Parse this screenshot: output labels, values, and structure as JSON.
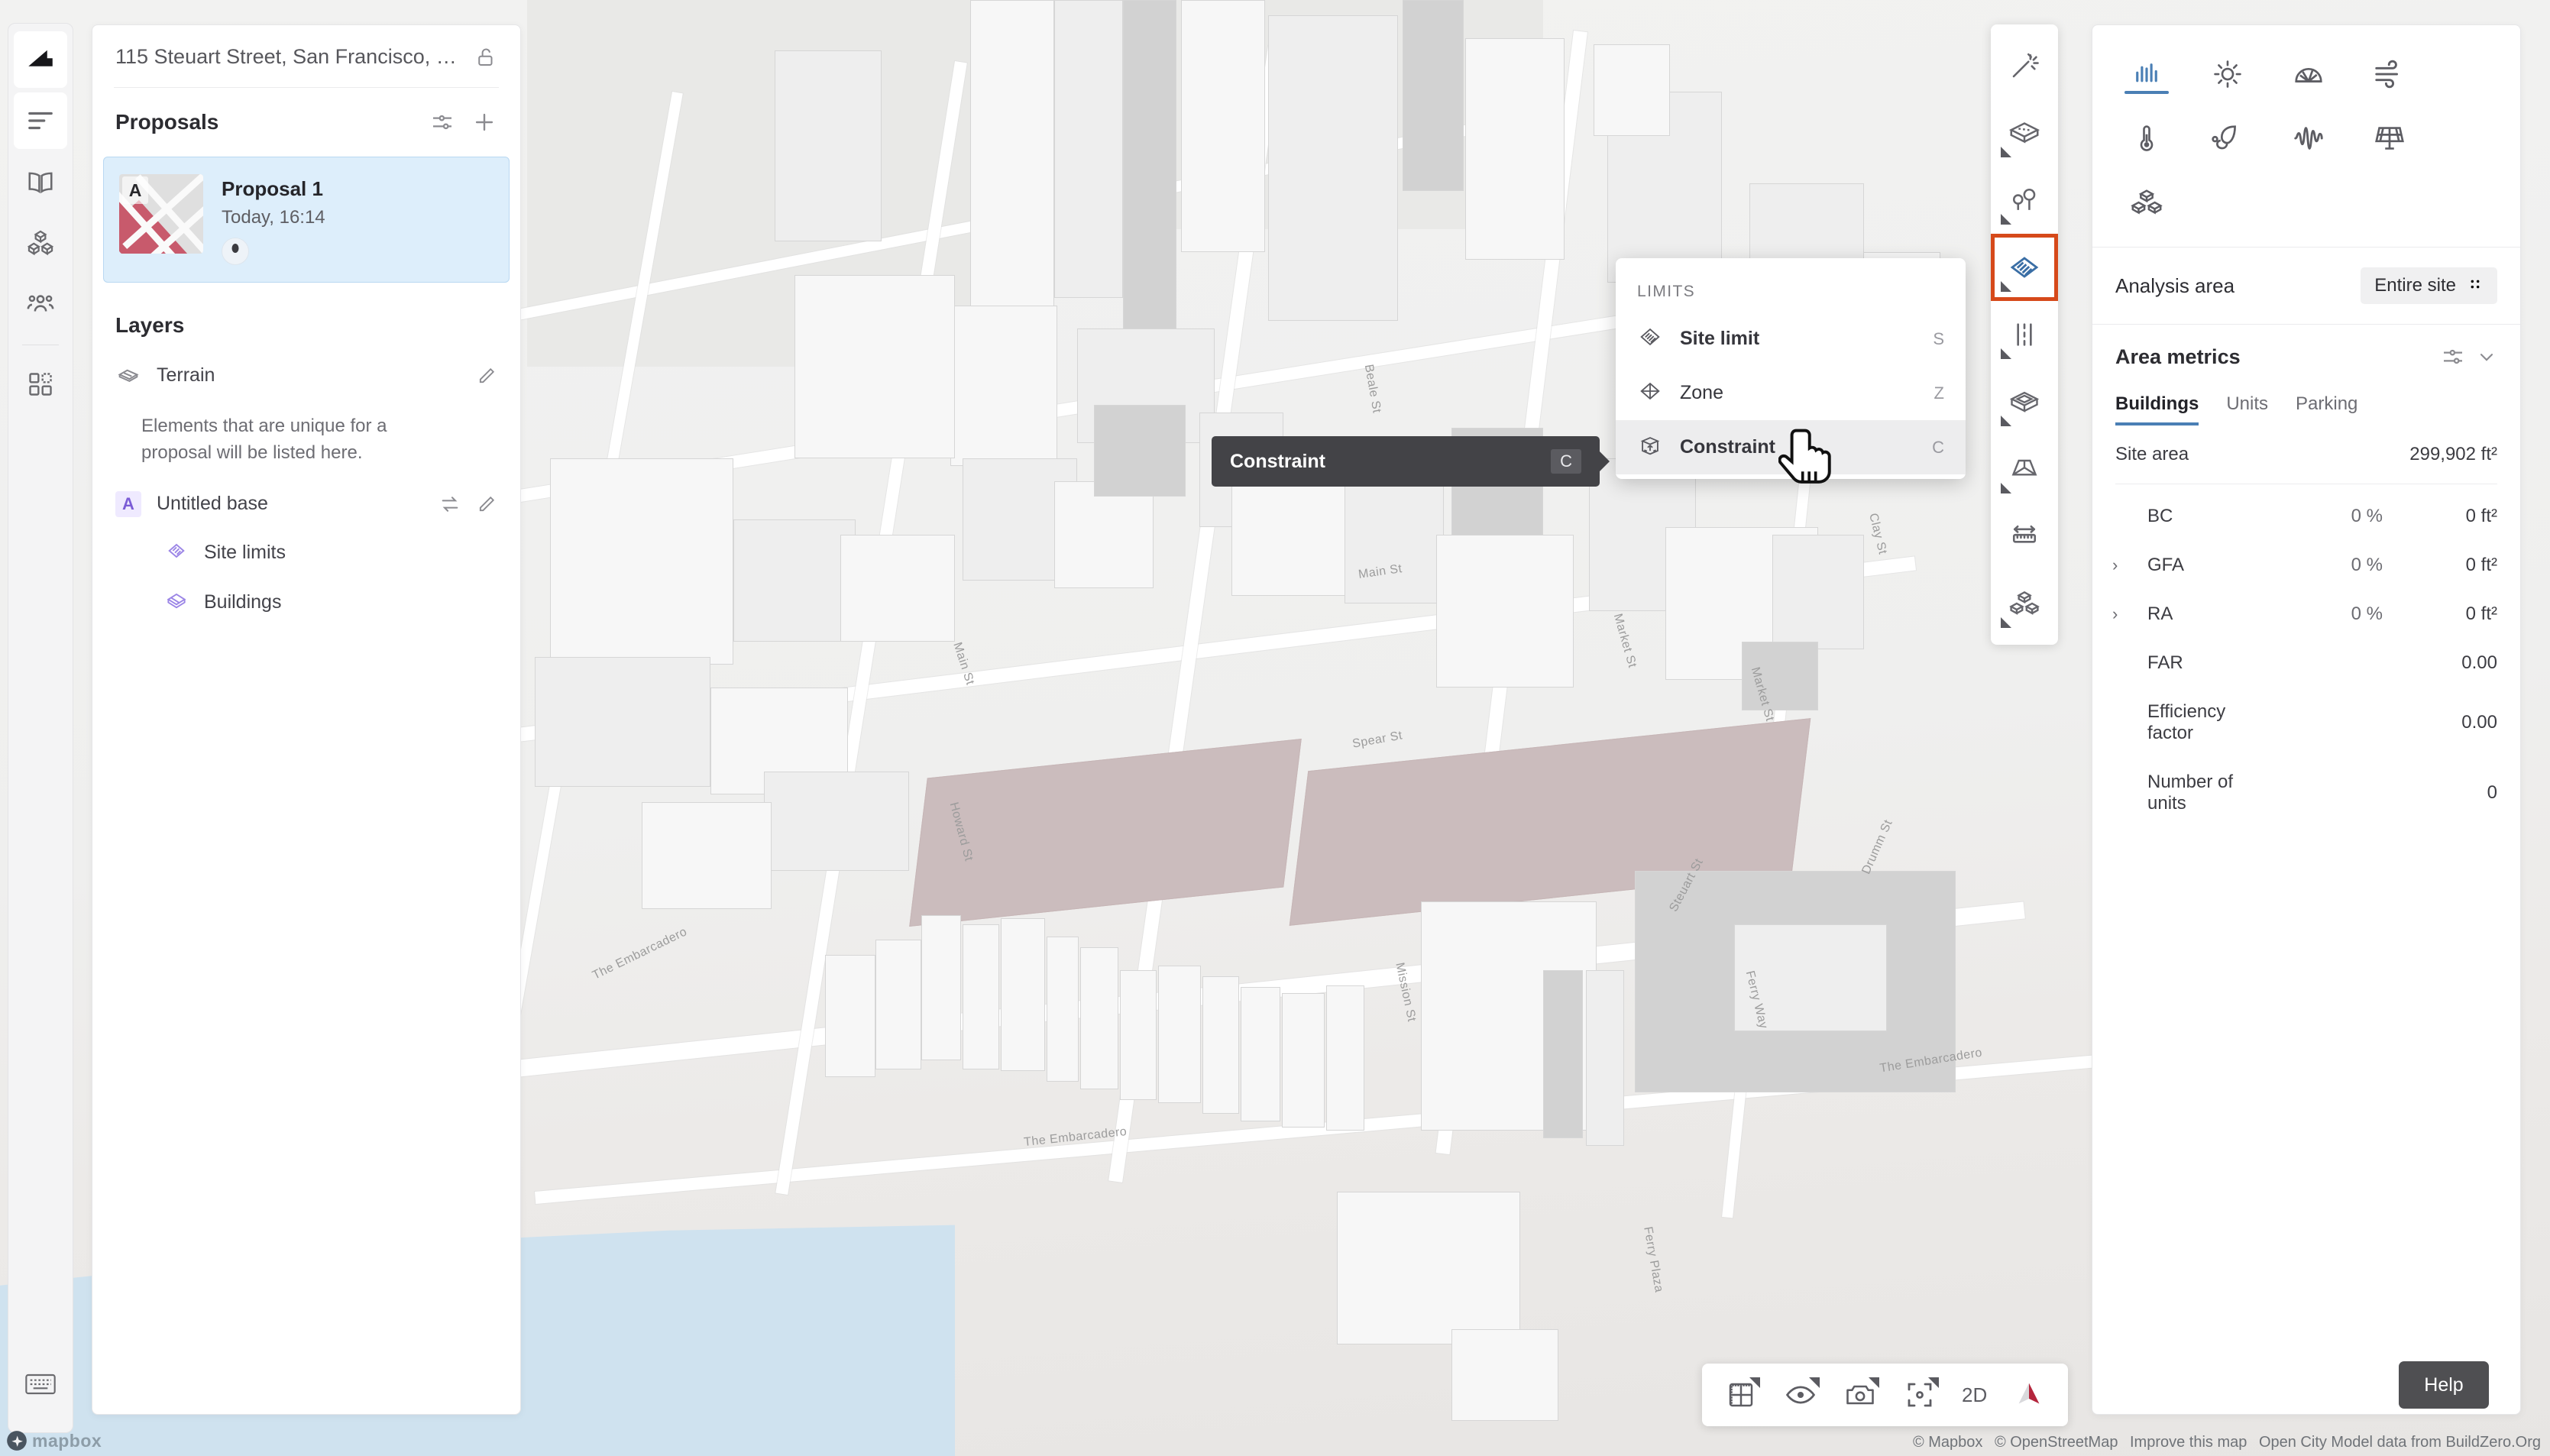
{
  "app": {
    "project_address": "115 Steuart Street, San Francisco, …",
    "lock_icon": "unlock-icon",
    "logo_icon": "app-logo-icon"
  },
  "rail": {
    "items": [
      {
        "icon": "app-logo-icon",
        "name": "logo"
      },
      {
        "icon": "list-icon",
        "name": "project-list"
      },
      {
        "icon": "book-icon",
        "name": "library"
      },
      {
        "icon": "blocks-icon",
        "name": "massing"
      },
      {
        "icon": "people-icon",
        "name": "team"
      },
      {
        "icon": "apps-grid-icon",
        "name": "apps"
      }
    ],
    "bottom_icon": "keyboard-icon"
  },
  "proposals": {
    "heading": "Proposals",
    "settings_icon": "sliders-icon",
    "add_icon": "plus-icon",
    "items": [
      {
        "badge": "A",
        "name": "Proposal 1",
        "timestamp": "Today, 16:14",
        "selected": true
      }
    ]
  },
  "layers": {
    "heading": "Layers",
    "terrain": {
      "label": "Terrain",
      "icon": "terrain-icon",
      "edit_icon": "pencil-icon"
    },
    "hint": "Elements that are unique for a proposal will be listed here.",
    "base": {
      "badge": "A",
      "label": "Untitled base",
      "swap_icon": "swap-icon",
      "edit_icon": "pencil-icon",
      "children": [
        {
          "label": "Site limits",
          "icon": "site-limit-icon"
        },
        {
          "label": "Buildings",
          "icon": "buildings-icon"
        }
      ]
    }
  },
  "limits_menu": {
    "title": "LIMITS",
    "items": [
      {
        "label": "Site limit",
        "shortcut": "S",
        "icon": "site-limit-icon",
        "bold": true,
        "highlighted": false
      },
      {
        "label": "Zone",
        "shortcut": "Z",
        "icon": "zone-icon",
        "bold": false,
        "highlighted": false
      },
      {
        "label": "Constraint",
        "shortcut": "C",
        "icon": "constraint-icon",
        "bold": true,
        "highlighted": true
      }
    ]
  },
  "tooltip": {
    "label": "Constraint",
    "shortcut": "C"
  },
  "vertical_toolbar": {
    "items": [
      {
        "name": "magic-wand-icon",
        "active": false
      },
      {
        "name": "building-block-icon",
        "active": false
      },
      {
        "name": "trees-icon",
        "active": false
      },
      {
        "name": "site-limit-plane-icon",
        "active": true
      },
      {
        "name": "grid-lines-icon",
        "active": false
      },
      {
        "name": "extrusion-box-icon",
        "active": false
      },
      {
        "name": "volume-shape-icon",
        "active": false
      },
      {
        "name": "measure-arrow-icon",
        "active": false
      },
      {
        "name": "blocks-stack-icon",
        "active": false
      }
    ]
  },
  "analysis": {
    "icons": [
      {
        "name": "bar-chart-icon",
        "active": true
      },
      {
        "name": "sun-icon",
        "active": false
      },
      {
        "name": "daylight-dome-icon",
        "active": false
      },
      {
        "name": "wind-icon",
        "active": false
      },
      {
        "name": "thermometer-icon",
        "active": false
      },
      {
        "name": "carbon-leaf-icon",
        "active": false
      },
      {
        "name": "acoustics-wave-icon",
        "active": false
      },
      {
        "name": "solar-panel-icon",
        "active": false
      },
      {
        "name": "blocks-stack-icon",
        "active": false
      }
    ],
    "area_row": {
      "label": "Analysis area",
      "value": "Entire site",
      "picker_icon": "four-dots-icon"
    },
    "metrics_header": {
      "title": "Area metrics",
      "settings_icon": "sliders-icon",
      "collapse_icon": "chevron-down-icon"
    },
    "tabs": [
      {
        "label": "Buildings",
        "active": true
      },
      {
        "label": "Units",
        "active": false
      },
      {
        "label": "Parking",
        "active": false
      }
    ],
    "site_area": {
      "label": "Site area",
      "value": "299,902 ft²"
    },
    "rows": [
      {
        "label": "BC",
        "pct": "0 %",
        "value": "0 ft²",
        "expandable": false
      },
      {
        "label": "GFA",
        "pct": "0 %",
        "value": "0 ft²",
        "expandable": true
      },
      {
        "label": "RA",
        "pct": "0 %",
        "value": "0 ft²",
        "expandable": true
      },
      {
        "label": "FAR",
        "pct": "",
        "value": "0.00",
        "expandable": false
      },
      {
        "label": "Efficiency factor",
        "pct": "",
        "value": "0.00",
        "expandable": false
      },
      {
        "label": "Number of units",
        "pct": "",
        "value": "0",
        "expandable": false
      }
    ]
  },
  "bottom_toolbar": {
    "items": [
      {
        "name": "ruler-grid-icon",
        "label": ""
      },
      {
        "name": "eye-icon",
        "label": ""
      },
      {
        "name": "camera-icon",
        "label": ""
      },
      {
        "name": "focus-icon",
        "label": ""
      },
      {
        "name": "view-mode-toggle",
        "label": "2D"
      },
      {
        "name": "compass-icon",
        "label": ""
      }
    ]
  },
  "help": {
    "label": "Help"
  },
  "map": {
    "mapbox_label": "mapbox",
    "attribution": [
      "© Mapbox",
      "© OpenStreetMap",
      "Improve this map",
      "Open City Model data from BuildZero.Org"
    ],
    "street_labels": [
      "Howard St",
      "Main St",
      "Spear St",
      "Market St",
      "Steuart St",
      "Mission St",
      "The Embarcadero",
      "The Embarcadero",
      "Ferry Plaza",
      "Drumm St",
      "Beale St",
      "Clay St"
    ],
    "site_limit_color": "#cbbcbd",
    "accent_color": "#d6491a",
    "selection_color": "#4a7fb5"
  }
}
